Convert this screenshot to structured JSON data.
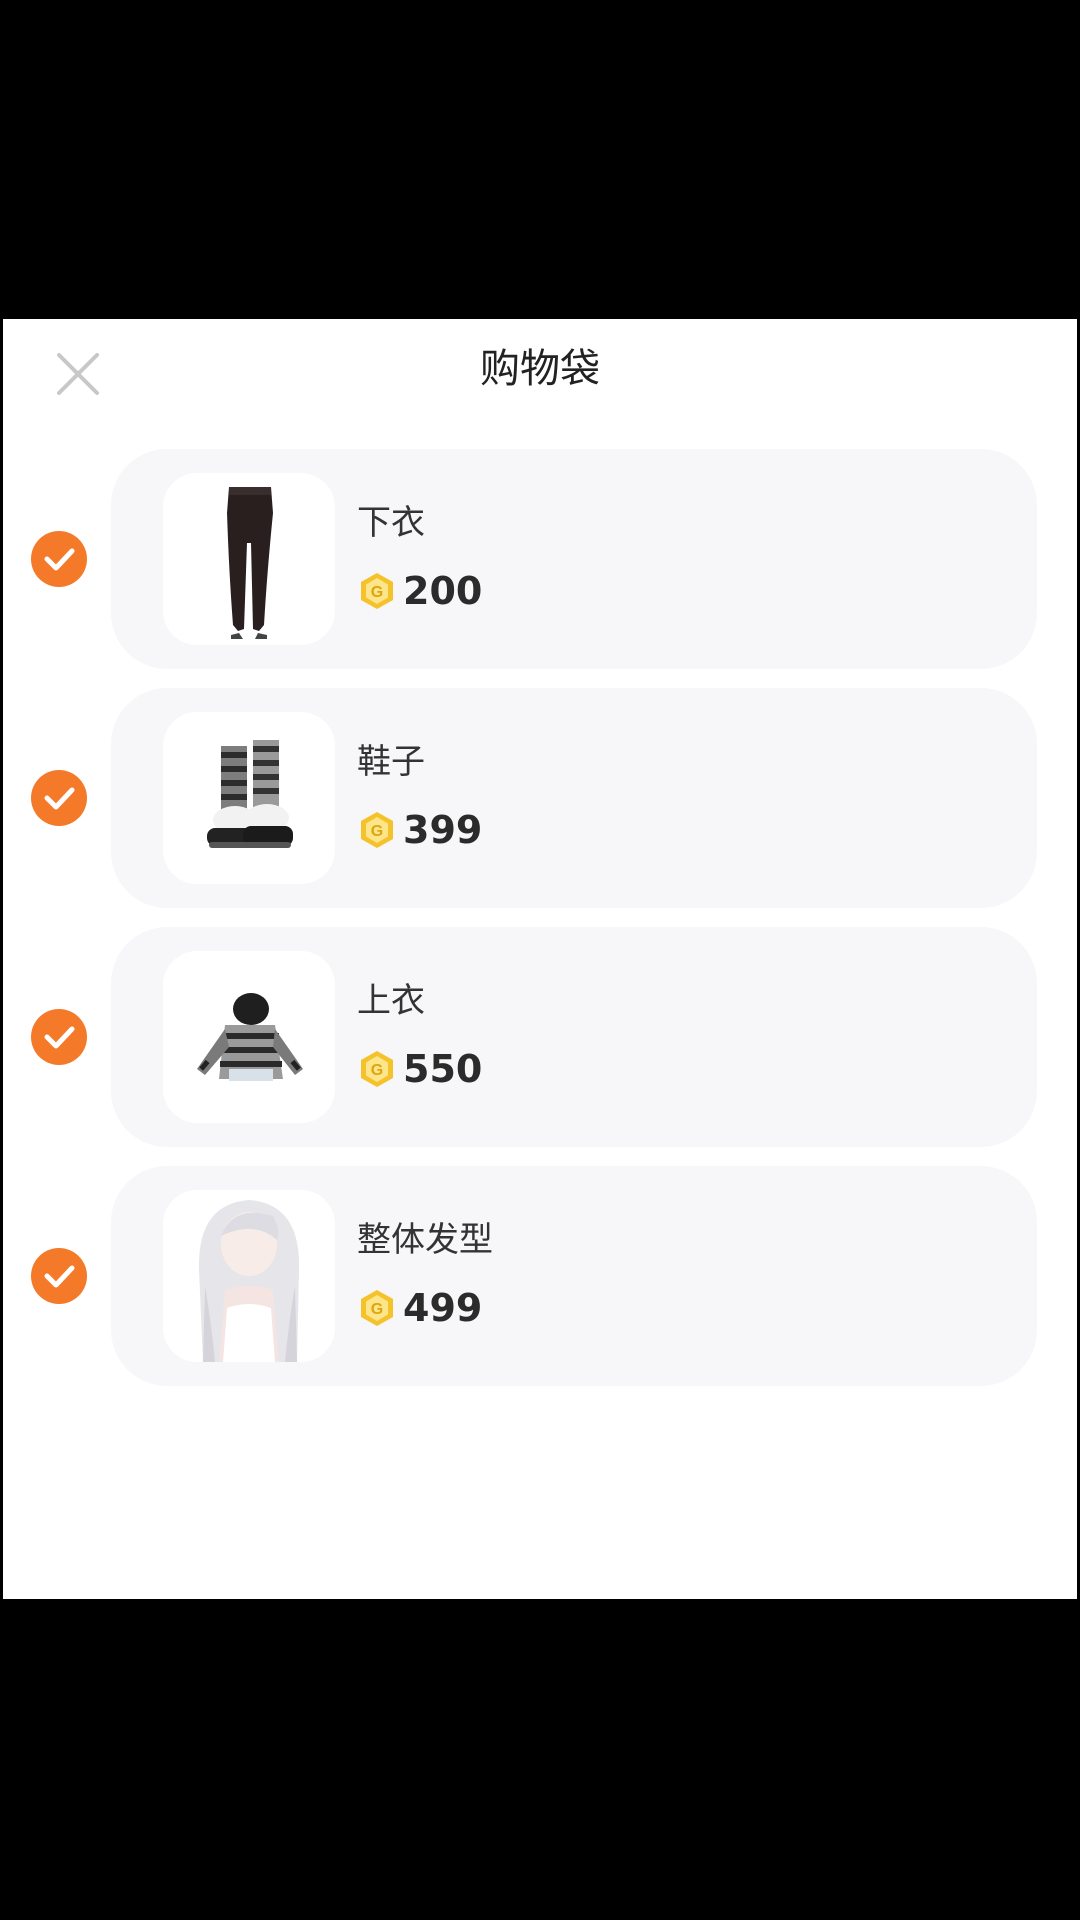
{
  "header": {
    "title": "购物袋",
    "close_icon": "close-icon"
  },
  "colors": {
    "accent": "#f47a2a",
    "coin": "#f5c22c",
    "card_bg": "#f7f7f9"
  },
  "items": [
    {
      "name": "下衣",
      "price": "200",
      "selected": true,
      "thumbnail": "black-leggings"
    },
    {
      "name": "鞋子",
      "price": "399",
      "selected": true,
      "thumbnail": "striped-platform-boots"
    },
    {
      "name": "上衣",
      "price": "550",
      "selected": true,
      "thumbnail": "striped-hooded-jacket"
    },
    {
      "name": "整体发型",
      "price": "499",
      "selected": true,
      "thumbnail": "long-silver-hair"
    }
  ],
  "currency_icon": "coin-icon"
}
